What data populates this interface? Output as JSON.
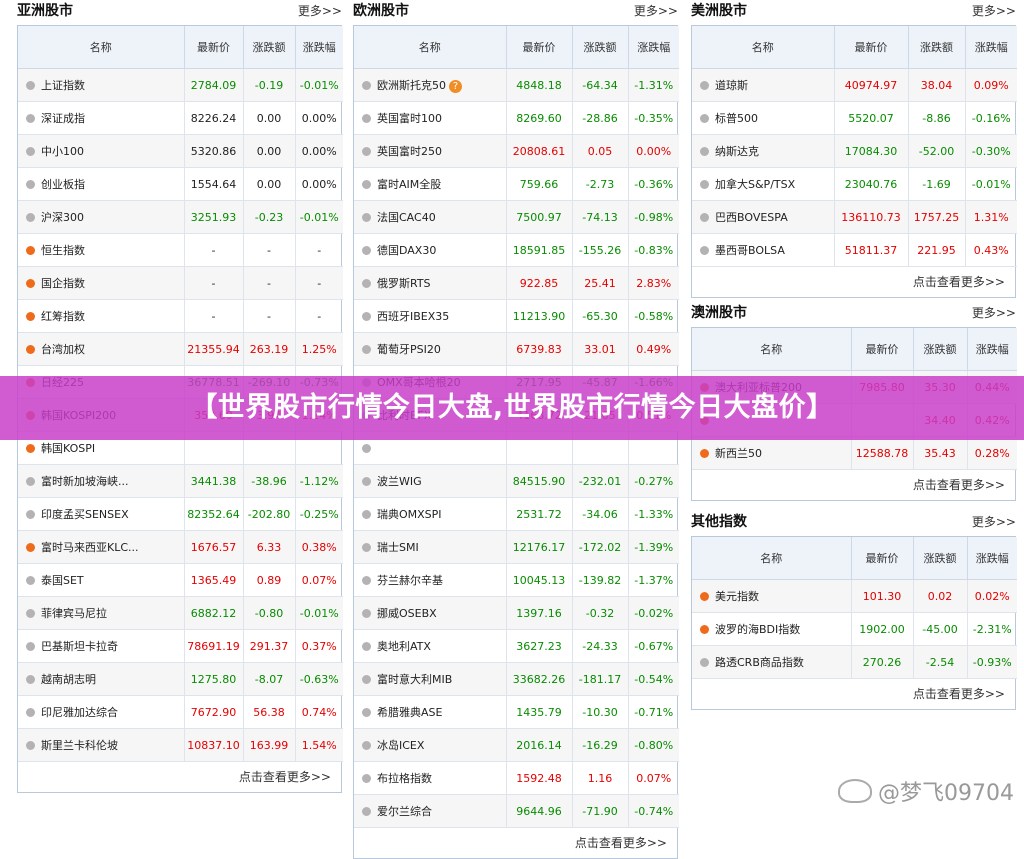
{
  "panels": {
    "asia": {
      "title": "亚洲股市",
      "more": "更多>>",
      "headers": [
        "名称",
        "最新价",
        "涨跌额",
        "涨跌幅"
      ],
      "rows": [
        {
          "name": "上证指数",
          "price": "2784.09",
          "chg": "-0.19",
          "pct": "-0.01%",
          "dir": "down",
          "dot": "gray"
        },
        {
          "name": "深证成指",
          "price": "8226.24",
          "chg": "0.00",
          "pct": "0.00%",
          "dir": "flat",
          "dot": "gray"
        },
        {
          "name": "中小100",
          "price": "5320.86",
          "chg": "0.00",
          "pct": "0.00%",
          "dir": "flat",
          "dot": "gray"
        },
        {
          "name": "创业板指",
          "price": "1554.64",
          "chg": "0.00",
          "pct": "0.00%",
          "dir": "flat",
          "dot": "gray"
        },
        {
          "name": "沪深300",
          "price": "3251.93",
          "chg": "-0.23",
          "pct": "-0.01%",
          "dir": "down",
          "dot": "gray"
        },
        {
          "name": "恒生指数",
          "price": "-",
          "chg": "-",
          "pct": "-",
          "dir": "flat",
          "dot": "orange"
        },
        {
          "name": "国企指数",
          "price": "-",
          "chg": "-",
          "pct": "-",
          "dir": "flat",
          "dot": "orange"
        },
        {
          "name": "红筹指数",
          "price": "-",
          "chg": "-",
          "pct": "-",
          "dir": "flat",
          "dot": "orange"
        },
        {
          "name": "台湾加权",
          "price": "21355.94",
          "chg": "263.19",
          "pct": "1.25%",
          "dir": "up",
          "dot": "orange"
        },
        {
          "name": "日经225",
          "price": "36778.51",
          "chg": "-269.10",
          "pct": "-0.73%",
          "dir": "down",
          "dot": "orange"
        },
        {
          "name": "韩国KOSPI200",
          "price": "350.60",
          "chg": "3.94",
          "pct": "1.14%",
          "dir": "up",
          "dot": "orange"
        },
        {
          "name": "韩国KOSPI",
          "price": "",
          "chg": "",
          "pct": "",
          "dir": "up",
          "dot": "orange"
        },
        {
          "name": "富时新加坡海峡...",
          "price": "3441.38",
          "chg": "-38.96",
          "pct": "-1.12%",
          "dir": "down",
          "dot": "gray"
        },
        {
          "name": "印度孟买SENSEX",
          "price": "82352.64",
          "chg": "-202.80",
          "pct": "-0.25%",
          "dir": "down",
          "dot": "gray"
        },
        {
          "name": "富时马来西亚KLC...",
          "price": "1676.57",
          "chg": "6.33",
          "pct": "0.38%",
          "dir": "up",
          "dot": "orange"
        },
        {
          "name": "泰国SET",
          "price": "1365.49",
          "chg": "0.89",
          "pct": "0.07%",
          "dir": "up",
          "dot": "gray"
        },
        {
          "name": "菲律宾马尼拉",
          "price": "6882.12",
          "chg": "-0.80",
          "pct": "-0.01%",
          "dir": "down",
          "dot": "gray"
        },
        {
          "name": "巴基斯坦卡拉奇",
          "price": "78691.19",
          "chg": "291.37",
          "pct": "0.37%",
          "dir": "up",
          "dot": "gray"
        },
        {
          "name": "越南胡志明",
          "price": "1275.80",
          "chg": "-8.07",
          "pct": "-0.63%",
          "dir": "down",
          "dot": "gray"
        },
        {
          "name": "印尼雅加达综合",
          "price": "7672.90",
          "chg": "56.38",
          "pct": "0.74%",
          "dir": "up",
          "dot": "gray"
        },
        {
          "name": "斯里兰卡科伦坡",
          "price": "10837.10",
          "chg": "163.99",
          "pct": "1.54%",
          "dir": "up",
          "dot": "gray"
        }
      ],
      "footer": "点击查看更多>>"
    },
    "europe": {
      "title": "欧洲股市",
      "more": "更多>>",
      "headers": [
        "名称",
        "最新价",
        "涨跌额",
        "涨跌幅"
      ],
      "rows": [
        {
          "name": "欧洲斯托克50",
          "price": "4848.18",
          "chg": "-64.34",
          "pct": "-1.31%",
          "dir": "down",
          "dot": "gray",
          "badge": "?"
        },
        {
          "name": "英国富时100",
          "price": "8269.60",
          "chg": "-28.86",
          "pct": "-0.35%",
          "dir": "down",
          "dot": "gray"
        },
        {
          "name": "英国富时250",
          "price": "20808.61",
          "chg": "0.05",
          "pct": "0.00%",
          "dir": "up",
          "dot": "gray"
        },
        {
          "name": "富时AIM全股",
          "price": "759.66",
          "chg": "-2.73",
          "pct": "-0.36%",
          "dir": "down",
          "dot": "gray"
        },
        {
          "name": "法国CAC40",
          "price": "7500.97",
          "chg": "-74.13",
          "pct": "-0.98%",
          "dir": "down",
          "dot": "gray"
        },
        {
          "name": "德国DAX30",
          "price": "18591.85",
          "chg": "-155.26",
          "pct": "-0.83%",
          "dir": "down",
          "dot": "gray"
        },
        {
          "name": "俄罗斯RTS",
          "price": "922.85",
          "chg": "25.41",
          "pct": "2.83%",
          "dir": "up",
          "dot": "gray"
        },
        {
          "name": "西班牙IBEX35",
          "price": "11213.90",
          "chg": "-65.30",
          "pct": "-0.58%",
          "dir": "down",
          "dot": "gray"
        },
        {
          "name": "葡萄牙PSI20",
          "price": "6739.83",
          "chg": "33.01",
          "pct": "0.49%",
          "dir": "up",
          "dot": "gray"
        },
        {
          "name": "OMX哥本哈根20",
          "price": "2717.95",
          "chg": "-45.87",
          "pct": "-1.66%",
          "dir": "down",
          "dot": "gray"
        },
        {
          "name": "比利时BFX",
          "price": "4168.72",
          "chg": "21.05",
          "pct": "0.51%",
          "dir": "up",
          "dot": "gray"
        },
        {
          "name": "",
          "price": "",
          "chg": "",
          "pct": "",
          "dir": "up",
          "dot": "gray"
        },
        {
          "name": "波兰WIG",
          "price": "84515.90",
          "chg": "-232.01",
          "pct": "-0.27%",
          "dir": "down",
          "dot": "gray"
        },
        {
          "name": "瑞典OMXSPI",
          "price": "2531.72",
          "chg": "-34.06",
          "pct": "-1.33%",
          "dir": "down",
          "dot": "gray"
        },
        {
          "name": "瑞士SMI",
          "price": "12176.17",
          "chg": "-172.02",
          "pct": "-1.39%",
          "dir": "down",
          "dot": "gray"
        },
        {
          "name": "芬兰赫尔辛基",
          "price": "10045.13",
          "chg": "-139.82",
          "pct": "-1.37%",
          "dir": "down",
          "dot": "gray"
        },
        {
          "name": "挪威OSEBX",
          "price": "1397.16",
          "chg": "-0.32",
          "pct": "-0.02%",
          "dir": "down",
          "dot": "gray"
        },
        {
          "name": "奥地利ATX",
          "price": "3627.23",
          "chg": "-24.33",
          "pct": "-0.67%",
          "dir": "down",
          "dot": "gray"
        },
        {
          "name": "富时意大利MIB",
          "price": "33682.26",
          "chg": "-181.17",
          "pct": "-0.54%",
          "dir": "down",
          "dot": "gray"
        },
        {
          "name": "希腊雅典ASE",
          "price": "1435.79",
          "chg": "-10.30",
          "pct": "-0.71%",
          "dir": "down",
          "dot": "gray"
        },
        {
          "name": "冰岛ICEX",
          "price": "2016.14",
          "chg": "-16.29",
          "pct": "-0.80%",
          "dir": "down",
          "dot": "gray"
        },
        {
          "name": "布拉格指数",
          "price": "1592.48",
          "chg": "1.16",
          "pct": "0.07%",
          "dir": "up",
          "dot": "gray"
        },
        {
          "name": "爱尔兰综合",
          "price": "9644.96",
          "chg": "-71.90",
          "pct": "-0.74%",
          "dir": "down",
          "dot": "gray"
        }
      ],
      "footer": "点击查看更多>>"
    },
    "america": {
      "title": "美洲股市",
      "more": "更多>>",
      "headers": [
        "名称",
        "最新价",
        "涨跌额",
        "涨跌幅"
      ],
      "rows": [
        {
          "name": "道琼斯",
          "price": "40974.97",
          "chg": "38.04",
          "pct": "0.09%",
          "dir": "up",
          "dot": "gray"
        },
        {
          "name": "标普500",
          "price": "5520.07",
          "chg": "-8.86",
          "pct": "-0.16%",
          "dir": "down",
          "dot": "gray"
        },
        {
          "name": "纳斯达克",
          "price": "17084.30",
          "chg": "-52.00",
          "pct": "-0.30%",
          "dir": "down",
          "dot": "gray"
        },
        {
          "name": "加拿大S&P/TSX",
          "price": "23040.76",
          "chg": "-1.69",
          "pct": "-0.01%",
          "dir": "down",
          "dot": "gray"
        },
        {
          "name": "巴西BOVESPA",
          "price": "136110.73",
          "chg": "1757.25",
          "pct": "1.31%",
          "dir": "up",
          "dot": "gray"
        },
        {
          "name": "墨西哥BOLSA",
          "price": "51811.37",
          "chg": "221.95",
          "pct": "0.43%",
          "dir": "up",
          "dot": "gray"
        }
      ],
      "footer": "点击查看更多>>"
    },
    "oceania": {
      "title": "澳洲股市",
      "more": "更多>>",
      "headers": [
        "名称",
        "最新价",
        "涨跌额",
        "涨跌幅"
      ],
      "rows": [
        {
          "name": "澳大利亚标普200",
          "price": "7985.80",
          "chg": "35.30",
          "pct": "0.44%",
          "dir": "up",
          "dot": "orange"
        },
        {
          "name": "",
          "price": "",
          "chg": "34.40",
          "pct": "0.42%",
          "dir": "up",
          "dot": "orange"
        },
        {
          "name": "新西兰50",
          "price": "12588.78",
          "chg": "35.43",
          "pct": "0.28%",
          "dir": "up",
          "dot": "orange"
        }
      ],
      "footer": "点击查看更多>>"
    },
    "other": {
      "title": "其他指数",
      "more": "更多>>",
      "headers": [
        "名称",
        "最新价",
        "涨跌额",
        "涨跌幅"
      ],
      "rows": [
        {
          "name": "美元指数",
          "price": "101.30",
          "chg": "0.02",
          "pct": "0.02%",
          "dir": "up",
          "dot": "orange"
        },
        {
          "name": "波罗的海BDI指数",
          "price": "1902.00",
          "chg": "-45.00",
          "pct": "-2.31%",
          "dir": "down",
          "dot": "orange"
        },
        {
          "name": "路透CRB商品指数",
          "price": "270.26",
          "chg": "-2.54",
          "pct": "-0.93%",
          "dir": "down",
          "dot": "gray"
        }
      ],
      "footer": "点击查看更多>>"
    }
  },
  "banner": {
    "text": "【世界股市行情今日大盘,世界股市行情今日大盘价】"
  },
  "watermark": {
    "text": "@梦飞09704"
  },
  "colors": {
    "up": "#e60000",
    "down": "#078c00",
    "header_bg": "#eef3fa",
    "border": "#b9c9dc",
    "banner": "#c83cc8"
  }
}
